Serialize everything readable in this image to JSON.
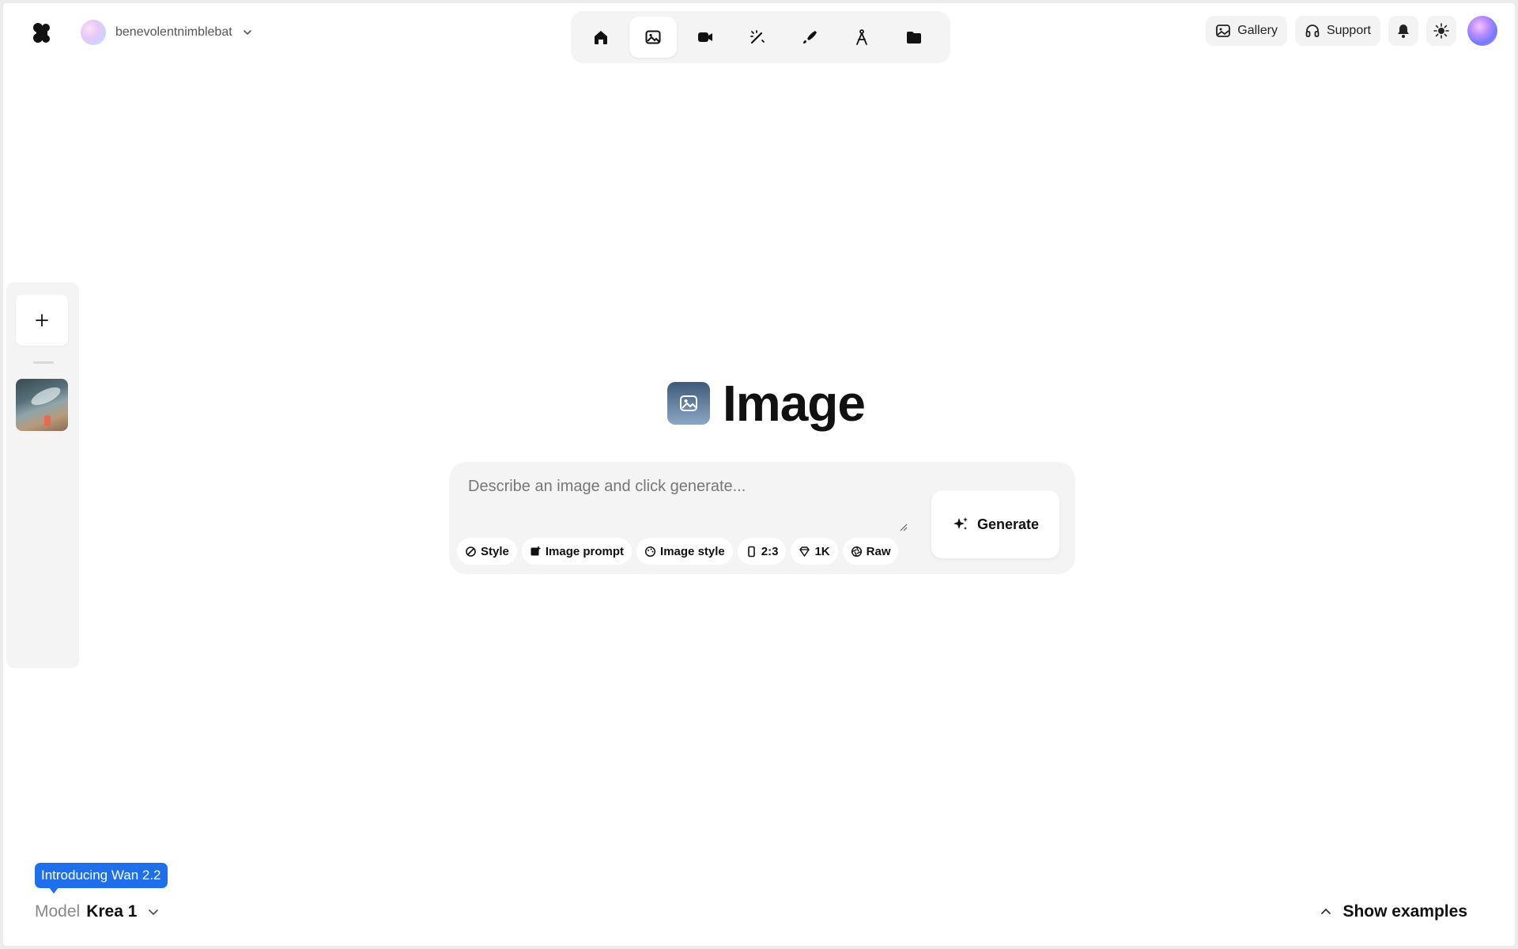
{
  "account": {
    "name": "benevolentnimblebat"
  },
  "tool_nav": [
    {
      "name": "Home",
      "icon": "home-icon",
      "active": false
    },
    {
      "name": "Image",
      "icon": "image-icon",
      "active": true
    },
    {
      "name": "Video",
      "icon": "video-icon",
      "active": false
    },
    {
      "name": "Enhance",
      "icon": "magic-wand-icon",
      "active": false
    },
    {
      "name": "Edit",
      "icon": "brush-icon",
      "active": false
    },
    {
      "name": "Train",
      "icon": "compass-icon",
      "active": false
    },
    {
      "name": "Assets",
      "icon": "folder-icon",
      "active": false
    }
  ],
  "header": {
    "gallery_label": "Gallery",
    "support_label": "Support"
  },
  "hero": {
    "title": "Image"
  },
  "prompt": {
    "placeholder": "Describe an image and click generate...",
    "value": ""
  },
  "chips": {
    "style": "Style",
    "image_prompt": "Image prompt",
    "image_style": "Image style",
    "aspect": "2:3",
    "resolution": "1K",
    "raw": "Raw"
  },
  "generate_label": "Generate",
  "promo": {
    "label": "Introducing Wan 2.2"
  },
  "model": {
    "label": "Model",
    "value": "Krea 1"
  },
  "show_examples_label": "Show examples",
  "colors": {
    "accent": "#1f6feb",
    "panel": "#f4f4f4"
  }
}
